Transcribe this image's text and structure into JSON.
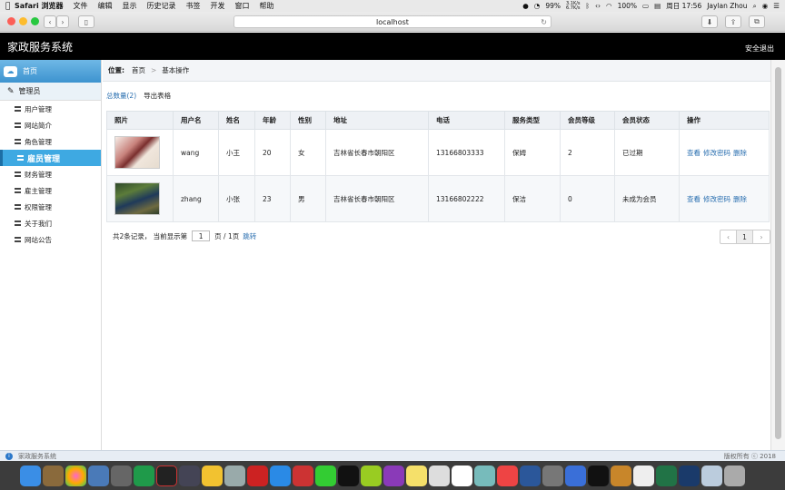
{
  "menubar": {
    "app": "Safari 浏览器",
    "items": [
      "文件",
      "编辑",
      "显示",
      "历史记录",
      "书签",
      "开发",
      "窗口",
      "帮助"
    ],
    "net_up": "3.1K/s",
    "net_down": "6.7K/s",
    "cpu": "99%",
    "battery": "100%",
    "clock": "周日 17:56",
    "user": "Jaylan Zhou"
  },
  "browser": {
    "url": "localhost"
  },
  "header": {
    "title": "家政服务系统",
    "logout": "安全退出"
  },
  "sidebar": {
    "home": "首页",
    "group": "管理员",
    "items": [
      {
        "label": "用户管理",
        "active": false
      },
      {
        "label": "网站简介",
        "active": false
      },
      {
        "label": "角色管理",
        "active": false
      },
      {
        "label": "雇员管理",
        "active": true
      },
      {
        "label": "财务管理",
        "active": false
      },
      {
        "label": "雇主管理",
        "active": false
      },
      {
        "label": "权限管理",
        "active": false
      },
      {
        "label": "关于我们",
        "active": false
      },
      {
        "label": "网站公告",
        "active": false
      }
    ]
  },
  "breadcrumb": {
    "prefix": "位置:",
    "home": "首页",
    "separator": ">",
    "current": "基本操作"
  },
  "toolbar": {
    "count": "总数量(2)",
    "export": "导出表格"
  },
  "table": {
    "headers": [
      "照片",
      "用户名",
      "姓名",
      "年龄",
      "性别",
      "地址",
      "电话",
      "服务类型",
      "会员等级",
      "会员状态",
      "操作"
    ],
    "rows": [
      {
        "username": "wang",
        "name": "小王",
        "age": "20",
        "gender": "女",
        "address": "吉林省长春市朝阳区",
        "phone": "13166803333",
        "service": "保姆",
        "level": "2",
        "status": "已过期"
      },
      {
        "username": "zhang",
        "name": "小张",
        "age": "23",
        "gender": "男",
        "address": "吉林省长春市朝阳区",
        "phone": "13166802222",
        "service": "保洁",
        "level": "0",
        "status": "未成为会员"
      }
    ],
    "actions": {
      "view": "查看",
      "edit": "修改密码",
      "delete": "删除"
    }
  },
  "pager": {
    "summary": "共2条记录，  当前显示第",
    "page_value": "1",
    "total": "页 / 1页",
    "jump": "跳转",
    "prev": "‹",
    "current": "1",
    "next": "›"
  },
  "statusbar": {
    "system": "家政服务系统",
    "copyright": "版权所有 ⓒ 2018"
  }
}
